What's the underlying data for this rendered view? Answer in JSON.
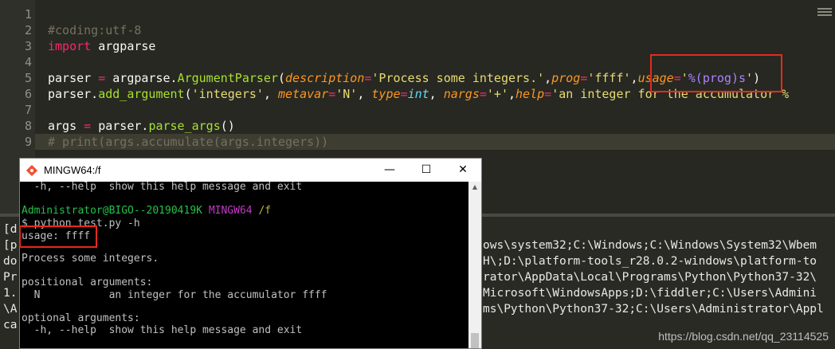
{
  "editor": {
    "line_numbers": [
      "1",
      "2",
      "3",
      "4",
      "5",
      "6",
      "7",
      "8",
      "9"
    ],
    "lines": [
      {
        "segments": []
      },
      {
        "segments": [
          {
            "t": "#coding:utf-8",
            "c": "cm"
          }
        ]
      },
      {
        "segments": [
          {
            "t": "import",
            "c": "kw"
          },
          {
            "t": " argparse",
            "c": ""
          }
        ]
      },
      {
        "segments": []
      },
      {
        "segments": [
          {
            "t": "parser ",
            "c": ""
          },
          {
            "t": "=",
            "c": "op"
          },
          {
            "t": " argparse.",
            "c": ""
          },
          {
            "t": "ArgumentParser",
            "c": "cls"
          },
          {
            "t": "(",
            "c": ""
          },
          {
            "t": "description",
            "c": "arg"
          },
          {
            "t": "=",
            "c": "op"
          },
          {
            "t": "'Process some integers.'",
            "c": "str"
          },
          {
            "t": ",",
            "c": ""
          },
          {
            "t": "prog",
            "c": "arg"
          },
          {
            "t": "=",
            "c": "op"
          },
          {
            "t": "'ffff'",
            "c": "str"
          },
          {
            "t": ",",
            "c": ""
          },
          {
            "t": "usage",
            "c": "arg"
          },
          {
            "t": "=",
            "c": "op"
          },
          {
            "t": "'",
            "c": "str"
          },
          {
            "t": "%(prog)s",
            "c": "fmt"
          },
          {
            "t": "'",
            "c": "str"
          },
          {
            "t": ")",
            "c": ""
          }
        ]
      },
      {
        "segments": [
          {
            "t": "parser.",
            "c": ""
          },
          {
            "t": "add_argument",
            "c": "cls"
          },
          {
            "t": "(",
            "c": ""
          },
          {
            "t": "'integers'",
            "c": "str"
          },
          {
            "t": ", ",
            "c": ""
          },
          {
            "t": "metavar",
            "c": "arg"
          },
          {
            "t": "=",
            "c": "op"
          },
          {
            "t": "'N'",
            "c": "str"
          },
          {
            "t": ", ",
            "c": ""
          },
          {
            "t": "type",
            "c": "arg"
          },
          {
            "t": "=",
            "c": "op"
          },
          {
            "t": "int",
            "c": "bt"
          },
          {
            "t": ", ",
            "c": ""
          },
          {
            "t": "nargs",
            "c": "arg"
          },
          {
            "t": "=",
            "c": "op"
          },
          {
            "t": "'+'",
            "c": "str"
          },
          {
            "t": ",",
            "c": ""
          },
          {
            "t": "help",
            "c": "arg"
          },
          {
            "t": "=",
            "c": "op"
          },
          {
            "t": "'an integer for the accumulator %",
            "c": "str"
          }
        ]
      },
      {
        "segments": []
      },
      {
        "segments": [
          {
            "t": "args ",
            "c": ""
          },
          {
            "t": "=",
            "c": "op"
          },
          {
            "t": " parser.",
            "c": ""
          },
          {
            "t": "parse_args",
            "c": "cls"
          },
          {
            "t": "()",
            "c": ""
          }
        ]
      },
      {
        "segments": [
          {
            "t": "# print(args.accumulate(args.integers))",
            "c": "cm"
          }
        ]
      }
    ]
  },
  "console": {
    "left_lines": [
      "[d",
      "[p",
      "do",
      "Pr",
      "1.",
      "\\A",
      "ca"
    ],
    "right_lines": [
      "ows\\system32;C:\\Windows;C:\\Windows\\System32\\Wbem",
      "H\\;D:\\platform-tools_r28.0.2-windows\\platform-to",
      "rator\\AppData\\Local\\Programs\\Python\\Python37-32\\",
      "Microsoft\\WindowsApps;D:\\fiddler;C:\\Users\\Admini",
      "ms\\Python\\Python37-32;C:\\Users\\Administrator\\Appl"
    ],
    "watermark": "https://blog.csdn.net/qq_23114525"
  },
  "terminal": {
    "title": "MINGW64:/f",
    "minimize": "—",
    "maximize": "☐",
    "close": "✕",
    "help_line": "  -h, --help  show this help message and exit",
    "prompt_user": "Administrator@BIGO--20190419K",
    "prompt_shell": "MINGW64",
    "prompt_dir": "/f",
    "command": "$ python test.py -h",
    "usage": "usage: ffff",
    "description": "Process some integers.",
    "positional_header": "positional arguments:",
    "positional_line": "  N           an integer for the accumulator ffff",
    "optional_header": "optional arguments:",
    "optional_line": "  -h, --help  show this help message and exit"
  },
  "colors": {
    "highlight": "#e8291c",
    "editor_bg": "#272822"
  }
}
